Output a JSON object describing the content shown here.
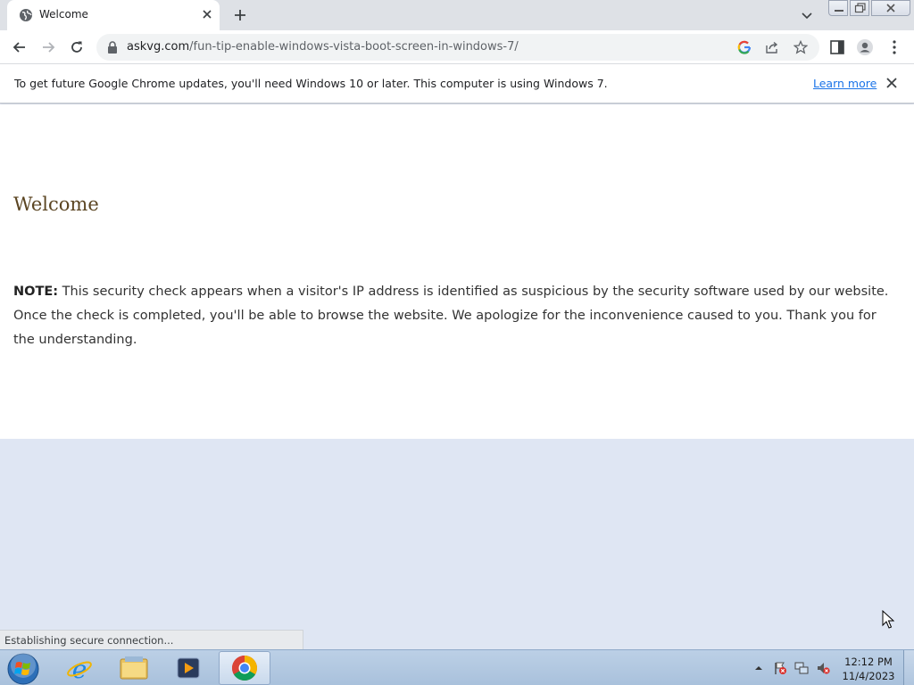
{
  "browser": {
    "tab": {
      "title": "Welcome"
    },
    "address": {
      "host": "askvg.com",
      "path": "/fun-tip-enable-windows-vista-boot-screen-in-windows-7/"
    },
    "infobar": {
      "message": "To get future Google Chrome updates, you'll need Windows 10 or later. This computer is using Windows 7.",
      "link": "Learn more"
    },
    "status": "Establishing secure connection..."
  },
  "page": {
    "heading": "Welcome",
    "note_label": "NOTE:",
    "note_text": " This security check appears when a visitor's IP address is identified as suspicious by the security software used by our website. Once the check is completed, you'll be able to browse the website. We apologize for the inconvenience caused to you. Thank you for the understanding."
  },
  "taskbar": {
    "apps": [
      "internet-explorer-icon",
      "windows-explorer-icon",
      "media-player-icon",
      "chrome-icon"
    ],
    "clock": {
      "time": "12:12 PM",
      "date": "11/4/2023"
    }
  },
  "colors": {
    "heading": "#5b4522",
    "link": "#1a73e8",
    "tabstrip": "#dee1e6",
    "desktop_bg": "#dfe6f3"
  }
}
